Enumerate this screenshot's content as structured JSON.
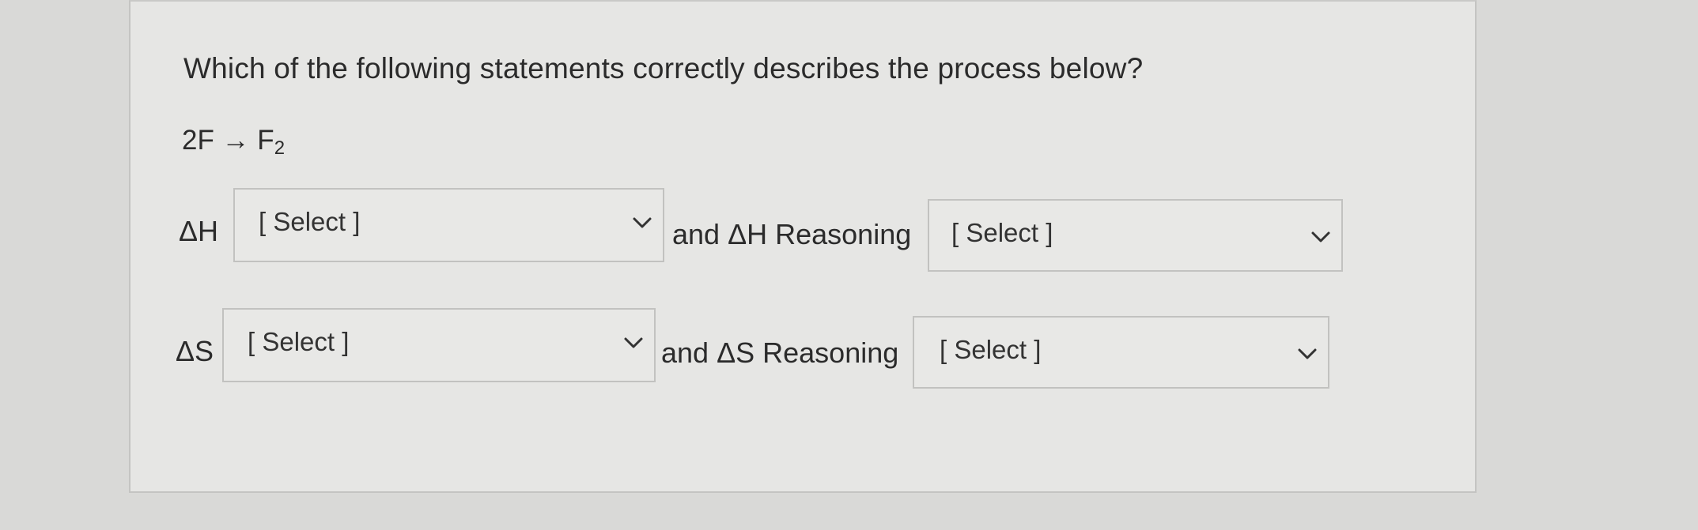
{
  "question": {
    "prompt": "Which of the following statements correctly describes the process below?",
    "equation_lhs": "2F → F",
    "equation_subscript": "2"
  },
  "rows": [
    {
      "label": "ΔH",
      "select_value": "[ Select ]",
      "reasoning_label": "and ΔH Reasoning",
      "reasoning_select_value": "[ Select ]"
    },
    {
      "label": "ΔS",
      "select_value": "[ Select ]",
      "reasoning_label": "and ΔS Reasoning",
      "reasoning_select_value": "[ Select ]"
    }
  ],
  "icons": {
    "dropdown": "chevron-down-icon"
  }
}
